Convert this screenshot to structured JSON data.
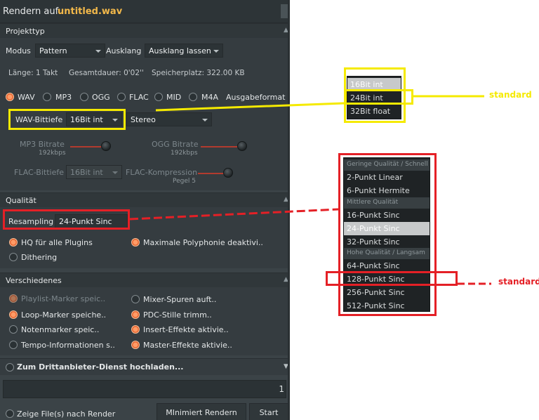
{
  "title": {
    "prefix": "Rendern auf",
    "filename": "untitled.wav"
  },
  "projekttyp": {
    "header": "Projekttyp",
    "modus_label": "Modus",
    "modus_value": "Pattern",
    "ausklang_label": "Ausklang",
    "ausklang_value": "Ausklang lassen",
    "laenge": "Länge: 1 Takt",
    "gesamtdauer": "Gesamtdauer: 0'02''",
    "speicherplatz": "Speicherplatz: 322.00 KB"
  },
  "formats": {
    "items": [
      "WAV",
      "MP3",
      "OGG",
      "FLAC",
      "MID",
      "M4A"
    ],
    "selected": "WAV",
    "ausgabeformat_label": "Ausgabeformat"
  },
  "wav": {
    "bittiefe_label": "WAV-Bittiefe",
    "bittiefe_value": "16Bit int",
    "channel_value": "Stereo"
  },
  "mp3": {
    "label": "MP3 Bitrate",
    "value": "192kbps"
  },
  "ogg": {
    "label": "OGG Bitrate",
    "value": "192kbps"
  },
  "flac": {
    "bittiefe_label": "FLAC-Bittiefe",
    "bittiefe_value": "16Bit int",
    "kompression_label": "FLAC-Kompression",
    "kompression_value": "Pegel 5"
  },
  "qualitaet": {
    "header": "Qualität",
    "resampling_label": "Resampling",
    "resampling_value": "24-Punkt Sinc",
    "hq_label": "HQ für alle Plugins",
    "polyphonie_label": "Maximale Polyphonie deaktivi..",
    "dithering_label": "Dithering"
  },
  "verschiedenes": {
    "header": "Verschiedenes",
    "left": [
      "Playlist-Marker speic..",
      "Loop-Marker speiche..",
      "Notenmarker speic..",
      "Tempo-Informationen s.."
    ],
    "right": [
      "Mixer-Spuren auft..",
      "PDC-Stille trimm..",
      "Insert-Effekte aktivie..",
      "Master-Effekte aktivie.."
    ]
  },
  "upload_label": "Zum Drittanbieter-Dienst hochladen...",
  "progress_value": "1",
  "footer": {
    "zeige_label": "Zeige File(s) nach Render",
    "minimiert_label": "MInimiert Rendern",
    "start_label": "Start"
  },
  "bit_popup": {
    "items": [
      "16Bit int",
      "24Bit int",
      "32Bit float"
    ],
    "selected": "16Bit int"
  },
  "resampling_popup": {
    "group1": "Geringe Qualität / Schnell",
    "group1_items": [
      "2-Punkt Linear",
      "6-Punkt Hermite"
    ],
    "group2": "Mittlere Qualität",
    "group2_items": [
      "16-Punkt Sinc",
      "24-Punkt Sinc",
      "32-Punkt Sinc"
    ],
    "group3": "Hohe Qualität / Langsam",
    "group3_items": [
      "64-Punkt Sinc",
      "128-Punkt Sinc",
      "256-Punkt Sinc",
      "512-Punkt Sinc"
    ],
    "selected": "24-Punkt Sinc"
  },
  "annotations": {
    "yellow_label": "standard",
    "red_label": "standard",
    "yellow_color": "#f5ea00",
    "red_color": "#e42026"
  }
}
